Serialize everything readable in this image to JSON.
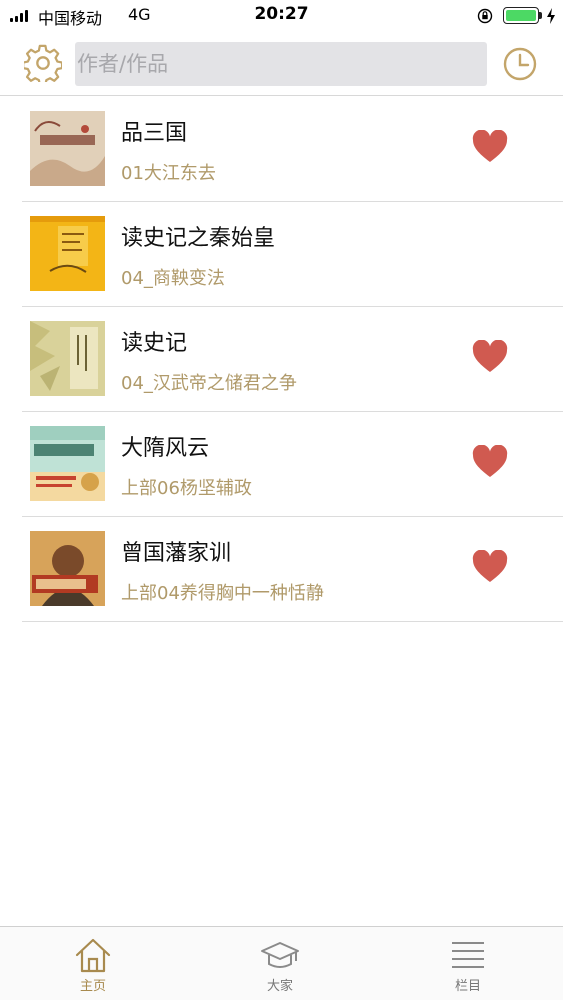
{
  "status_bar": {
    "carrier": "中国移动",
    "network": "4G",
    "time": "20:27"
  },
  "header": {
    "search_placeholder": "作者/作品",
    "settings_icon": "gear-icon",
    "history_icon": "clock-icon"
  },
  "colors": {
    "accent": "#c3a56a",
    "episode_text": "#b09a6a",
    "heart": "#d05a50"
  },
  "list": {
    "items": [
      {
        "title": "品三国",
        "episode": "01大江东去",
        "favorited": true
      },
      {
        "title": "读史记之秦始皇",
        "episode": "04_商鞅变法",
        "favorited": false
      },
      {
        "title": "读史记",
        "episode": "04_汉武帝之储君之争",
        "favorited": true
      },
      {
        "title": "大隋风云",
        "episode": "上部06杨坚辅政",
        "favorited": true
      },
      {
        "title": "曾国藩家训",
        "episode": "上部04养得胸中一种恬静",
        "favorited": true
      }
    ]
  },
  "tabbar": {
    "tabs": [
      {
        "label": "主页",
        "icon": "home-icon",
        "active": true
      },
      {
        "label": "大家",
        "icon": "graduation-cap-icon",
        "active": false
      },
      {
        "label": "栏目",
        "icon": "menu-lines-icon",
        "active": false
      }
    ]
  }
}
